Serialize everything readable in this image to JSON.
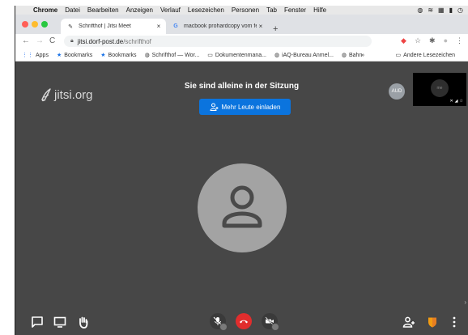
{
  "menubar": {
    "app": "Chrome",
    "items": [
      "Datei",
      "Bearbeiten",
      "Anzeigen",
      "Verlauf",
      "Lesezeichen",
      "Personen",
      "Tab",
      "Fenster",
      "Hilfe"
    ]
  },
  "tabs": [
    {
      "title": "Schrifthof | Jitsi Meet",
      "active": true
    },
    {
      "title": "macbook prohardcopy vom fe",
      "active": false
    }
  ],
  "address": {
    "domain": "jitsi.dorf-post.de",
    "path": "/schrifthof"
  },
  "bookmarks": {
    "items": [
      "Apps",
      "Bookmarks",
      "Bookmarks",
      "Schrifthof — Wor...",
      "Dokumentenmana...",
      "iAQ-Bureau Anmel...",
      "Bahn"
    ],
    "more": "»",
    "other": "Andere Lesezeichen"
  },
  "meeting": {
    "brand": "jitsi.org",
    "notice": "Sie sind alleine in der Sitzung",
    "invite_button": "Mehr Leute einladen",
    "participant_initials": "AUD",
    "self_label": "me"
  },
  "colors": {
    "meeting_bg": "#474747",
    "invite_blue": "#0b74de",
    "hangup_red": "#e12d2d",
    "shield_orange": "#f39c12"
  }
}
